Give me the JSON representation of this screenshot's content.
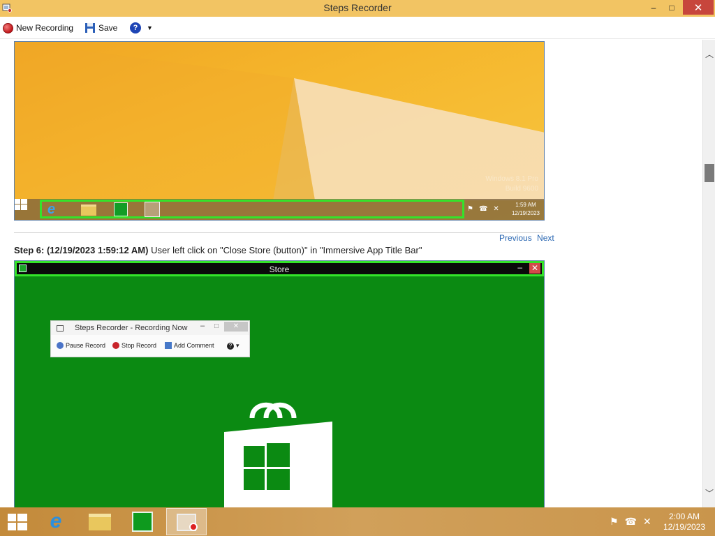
{
  "window": {
    "title": "Steps Recorder",
    "controls": {
      "minimize": "–",
      "maximize": "□",
      "close": "✕"
    }
  },
  "toolbar": {
    "new_recording_label": "New Recording",
    "save_label": "Save",
    "help_symbol": "?",
    "help_dropdown_symbol": "▼"
  },
  "screenshot1": {
    "watermark_line1": "Windows 8.1 Pro",
    "watermark_line2": "Build 9600",
    "tray_time": "1:59 AM",
    "tray_date": "12/19/2023"
  },
  "navigation": {
    "previous": "Previous",
    "next": "Next"
  },
  "step6": {
    "heading": "Step 6: (12/19/2023 1:59:12 AM)",
    "description": " User left click on \"Close Store (button)\" in \"Immersive App Title Bar\""
  },
  "screenshot2": {
    "app_title": "Store",
    "mini_recorder": {
      "title": "Steps Recorder - Recording Now",
      "pause": "Pause Record",
      "stop": "Stop Record",
      "add_comment": "Add Comment"
    }
  },
  "taskbar": {
    "time": "2:00 AM",
    "date": "12/19/2023"
  },
  "colors": {
    "titlebar": "#f2c463",
    "close_button": "#c7463c",
    "highlight_green": "#34e32a",
    "store_green": "#0b8a12",
    "link_blue": "#2a67b2"
  },
  "icons": [
    "app-icon",
    "record-icon",
    "save-icon",
    "help-icon",
    "windows-start-icon",
    "ie-icon",
    "file-explorer-icon",
    "store-icon",
    "steps-recorder-icon",
    "flag-icon",
    "network-icon",
    "volume-muted-icon"
  ]
}
